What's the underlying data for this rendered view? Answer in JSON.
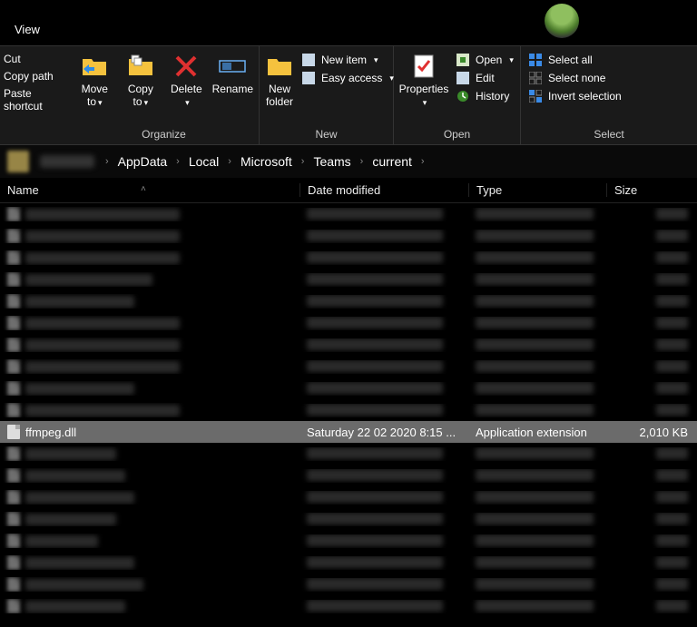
{
  "titlebar": {
    "view_tab": "View"
  },
  "clipboard": {
    "cut": "Cut",
    "copy_path": "Copy path",
    "paste_shortcut": "Paste shortcut"
  },
  "ribbon": {
    "organize": {
      "label": "Organize",
      "move_to": "Move to",
      "copy_to": "Copy to",
      "delete": "Delete",
      "rename": "Rename"
    },
    "new": {
      "label": "New",
      "new_folder": "New folder",
      "new_item": "New item",
      "easy_access": "Easy access"
    },
    "open": {
      "label": "Open",
      "properties": "Properties",
      "open": "Open",
      "edit": "Edit",
      "history": "History"
    },
    "select": {
      "label": "Select",
      "select_all": "Select all",
      "select_none": "Select none",
      "invert": "Invert selection"
    }
  },
  "breadcrumb": {
    "items": [
      "AppData",
      "Local",
      "Microsoft",
      "Teams",
      "current"
    ]
  },
  "columns": {
    "name": "Name",
    "date": "Date modified",
    "type": "Type",
    "size": "Size"
  },
  "selected_file": {
    "name": "ffmpeg.dll",
    "date": "Saturday 22 02 2020 8:15 ...",
    "type": "Application extension",
    "size": "2,010 KB"
  },
  "blur_rows_before": 10,
  "blur_rows_after": 8,
  "blur_widths": {
    "name": [
      170,
      170,
      170,
      140,
      120,
      170,
      170,
      170,
      120,
      170,
      100,
      110,
      120,
      100,
      80,
      120,
      130,
      110
    ],
    "date": [
      150,
      150,
      150,
      150,
      150,
      150,
      150,
      150,
      150,
      150,
      150,
      150,
      150,
      150,
      150,
      150,
      150,
      150
    ],
    "type": [
      130,
      130,
      130,
      130,
      130,
      130,
      130,
      130,
      130,
      130,
      130,
      130,
      130,
      130,
      130,
      130,
      130,
      130
    ],
    "size": [
      35,
      35,
      35,
      35,
      35,
      35,
      35,
      35,
      35,
      35,
      35,
      35,
      35,
      35,
      35,
      35,
      35,
      35
    ]
  }
}
